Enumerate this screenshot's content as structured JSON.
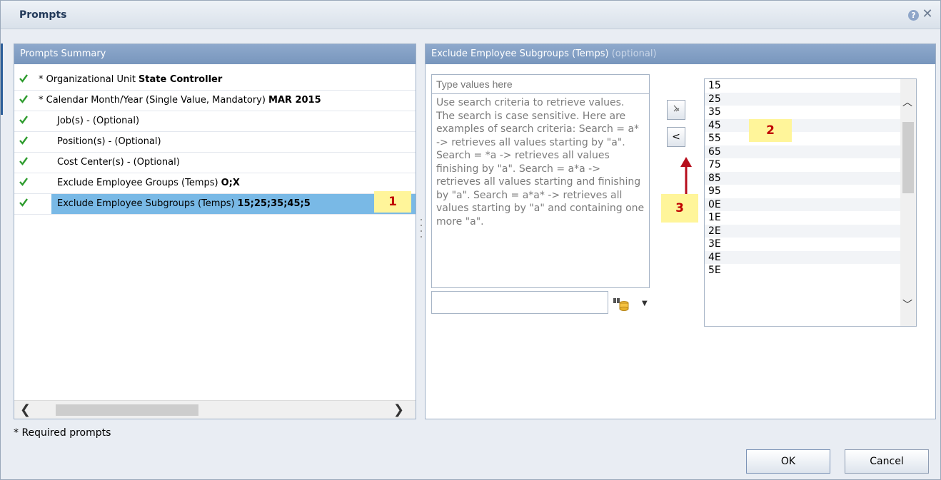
{
  "dialog": {
    "title": "Prompts"
  },
  "left_panel": {
    "title": "Prompts Summary",
    "items": [
      {
        "label": "* Organizational Unit",
        "value": "State Controller"
      },
      {
        "label": "* Calendar Month/Year (Single Value, Mandatory)",
        "value": "MAR 2015"
      },
      {
        "label": "Job(s) - (Optional)",
        "value": ""
      },
      {
        "label": "Position(s) - (Optional)",
        "value": ""
      },
      {
        "label": "Cost Center(s) - (Optional)",
        "value": ""
      },
      {
        "label": "Exclude Employee Groups (Temps)",
        "value": "O;X"
      },
      {
        "label": "Exclude Employee Subgroups (Temps)",
        "value": "15;25;35;45;5"
      }
    ],
    "callout": "1"
  },
  "right_panel": {
    "title": "Exclude Employee Subgroups (Temps)",
    "optional": "(optional)",
    "search_placeholder": "Type values here",
    "help_text": "Use search criteria to retrieve values. The search is case sensitive. Here are examples of search criteria: Search = a* -> retrieves all values starting by \"a\". Search = *a -> retrieves all values finishing by \"a\". Search = a*a -> retrieves all values starting and finishing by \"a\". Search = a*a* -> retrieves all values starting by \"a\" and containing one more \"a\".",
    "filter_value": "",
    "remove_label": "<",
    "selected_values": [
      "15",
      "25",
      "35",
      "45",
      "55",
      "65",
      "75",
      "85",
      "95",
      "0E",
      "1E",
      "2E",
      "3E",
      "4E",
      "5E"
    ],
    "callout_values": "2",
    "callout_button": "3"
  },
  "footer": {
    "note": "* Required prompts",
    "ok": "OK",
    "cancel": "Cancel"
  },
  "colors": {
    "header": "#7f9cc4",
    "selection": "#79b9e6",
    "callout_bg": "#fff59a",
    "callout_text": "#c00000",
    "check": "#2e9c2e"
  }
}
